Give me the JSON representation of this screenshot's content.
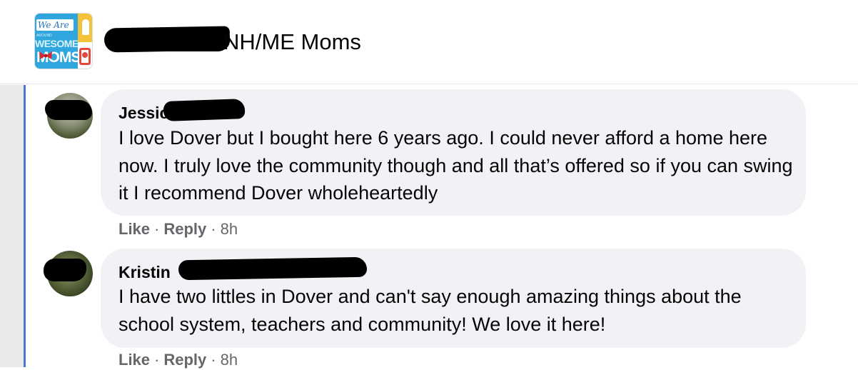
{
  "header": {
    "group_name_visible": "NH/ME Moms",
    "logo": {
      "tag_text": "We Are",
      "middle_text": "AROUND",
      "awesome_text": "WESOME",
      "moms_text": "MOMS"
    }
  },
  "comments": [
    {
      "author_visible": "Jessic",
      "body": "I love Dover but I bought here 6 years ago. I could never afford a home here now. I truly love the community though and all that’s offered so if you can swing it I recommend Dover wholeheartedly",
      "like_label": "Like",
      "reply_label": "Reply",
      "time": "8h"
    },
    {
      "author_visible": "Kristin",
      "body": "I have two littles in Dover and can't say enough amazing things about the school system, teachers and community! We love it here!",
      "like_label": "Like",
      "reply_label": "Reply",
      "time": "8h"
    }
  ],
  "colors": {
    "thread_line": "#4a77c9",
    "bubble": "#f0f2f5",
    "meta_text": "#65676b",
    "redaction": "#000000"
  },
  "icons": [
    "group-logo-icon",
    "user-avatar"
  ]
}
